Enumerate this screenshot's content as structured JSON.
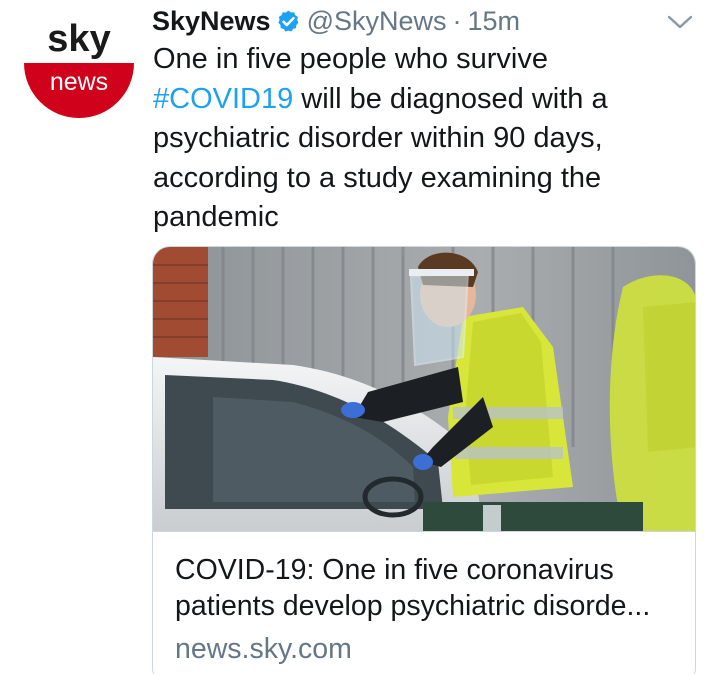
{
  "tweet": {
    "author": {
      "display_name": "SkyNews",
      "handle": "@SkyNews",
      "verified": true,
      "avatar": {
        "logo_top": "sky",
        "logo_bottom": "news",
        "colors": {
          "top": "#ffffff",
          "bottom": "#d0021b",
          "text_top": "#1a1a1a",
          "text_bottom": "#ffffff"
        }
      }
    },
    "separator": "·",
    "timestamp": "15m",
    "menu_icon": "chevron-down-icon",
    "text_lines": [
      "One in five people who survive",
      {
        "hashtag": "#COVID19",
        "rest": " will be diagnosed with a"
      },
      "psychiatric disorder within 90 days,",
      "according to a study examining the",
      "pandemic"
    ],
    "card": {
      "image": "photo of a health worker in face shield and hi-vis vest at a car window (drive-through testing)",
      "title_lines": [
        "COVID-19: One in five coronavirus",
        "patients develop psychiatric disorde..."
      ],
      "domain": "news.sky.com"
    }
  },
  "colors": {
    "link": "#1da1f2",
    "verified_badge": "#1da1f2",
    "muted_text": "#657786",
    "border": "#ccd6dd"
  }
}
